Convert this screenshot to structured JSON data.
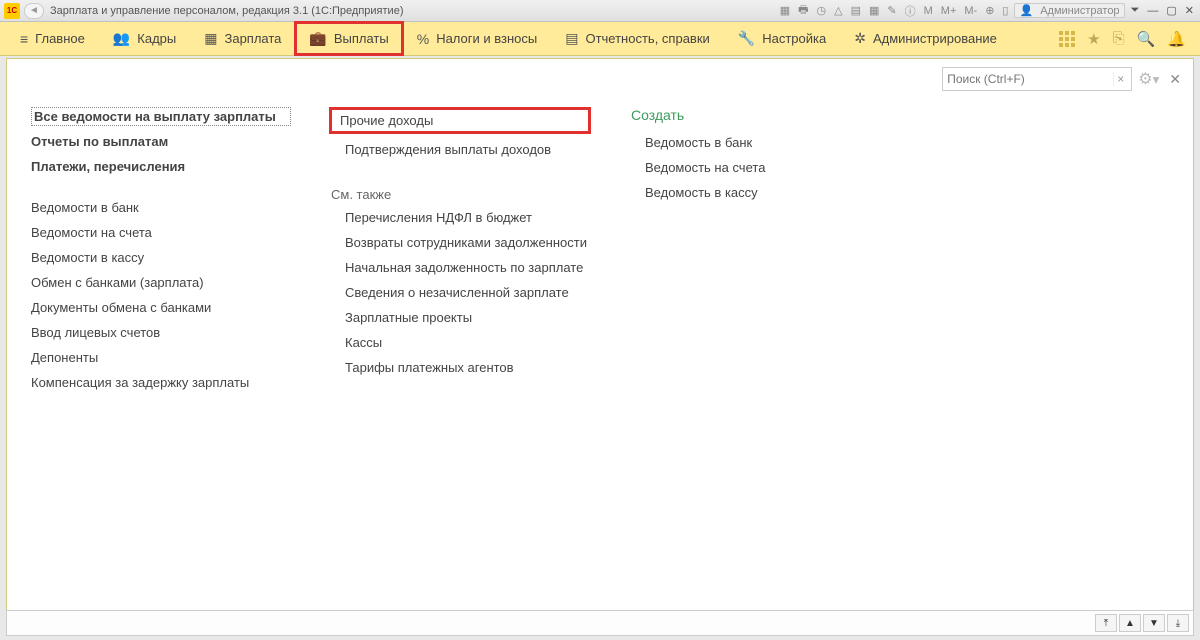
{
  "titlebar": {
    "logo_text": "1C",
    "back_glyph": "◄",
    "title": "Зарплата и управление персоналом, редакция 3.1  (1С:Предприятие)",
    "admin_label": "Администратор",
    "icons": {
      "calc": "▦",
      "print": "🖶",
      "clock": "◷",
      "up": "△",
      "save": "▤",
      "grid": "▦",
      "cal": "✎",
      "info": "ⓘ",
      "m": "M",
      "mplus": "M+",
      "mminus": "M-",
      "zoom": "⊕",
      "doc": "▯"
    },
    "win": {
      "help": "⏷",
      "min": "—",
      "max": "▢",
      "close": "✕"
    }
  },
  "menu": {
    "items": [
      {
        "icon": "≡",
        "label": "Главное"
      },
      {
        "icon": "👥",
        "label": "Кадры"
      },
      {
        "icon": "▦",
        "label": "Зарплата"
      },
      {
        "icon": "💼",
        "label": "Выплаты",
        "highlight": true
      },
      {
        "icon": "%",
        "label": "Налоги и взносы"
      },
      {
        "icon": "▤",
        "label": "Отчетность, справки"
      },
      {
        "icon": "🔧",
        "label": "Настройка"
      },
      {
        "icon": "✲",
        "label": "Администрирование"
      }
    ],
    "right_icons": {
      "star": "★",
      "copy": "⎘",
      "search": "🔍",
      "bell": "🔔"
    }
  },
  "search": {
    "placeholder": "Поиск (Ctrl+F)",
    "clear": "×"
  },
  "col1": {
    "top": [
      "Все ведомости на выплату зарплаты",
      "Отчеты по выплатам",
      "Платежи, перечисления"
    ],
    "list": [
      "Ведомости в банк",
      "Ведомости на счета",
      "Ведомости в кассу",
      "Обмен с банками (зарплата)",
      "Документы обмена с банками",
      "Ввод лицевых счетов",
      "Депоненты",
      "Компенсация за задержку зарплаты"
    ]
  },
  "col2": {
    "top_highlight": "Прочие доходы",
    "top2": "Подтверждения выплаты доходов",
    "section": "См. также",
    "list": [
      "Перечисления НДФЛ в бюджет",
      "Возвраты сотрудниками задолженности",
      "Начальная задолженность по зарплате",
      "Сведения о незачисленной зарплате",
      "Зарплатные проекты",
      "Кассы",
      "Тарифы платежных агентов"
    ]
  },
  "col3": {
    "head": "Создать",
    "list": [
      "Ведомость в банк",
      "Ведомость на счета",
      "Ведомость в кассу"
    ]
  },
  "bottom": {
    "b1": "⤒",
    "b2": "▲",
    "b3": "▼",
    "b4": "⤓"
  }
}
